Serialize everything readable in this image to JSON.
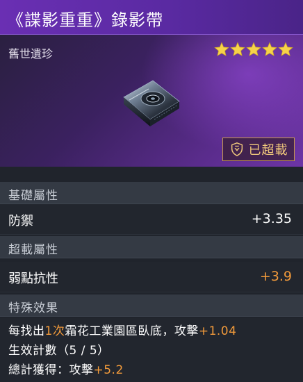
{
  "item": {
    "title": "《諜影重重》錄影帶",
    "rarity_label": "舊世遺珍",
    "stars": 5,
    "star_color": "#f6d34a",
    "status_badge": "已超載",
    "status_icon": "overload-shield-icon"
  },
  "sections": {
    "base": {
      "header": "基礎屬性",
      "stats": [
        {
          "name": "防禦",
          "value": "+3.35"
        }
      ]
    },
    "overload": {
      "header": "超載屬性",
      "stats": [
        {
          "name": "弱點抗性",
          "value": "+3.9"
        }
      ]
    },
    "special": {
      "header": "特殊效果",
      "line1_a": "每找出",
      "line1_b": "1次",
      "line1_c": "霜花工業園區臥底",
      "line1_d": "，攻擊",
      "line1_e": "+1.04",
      "line2": "生效計數（5 / 5）",
      "line3_a": "總計獲得：攻擊",
      "line3_b": "+5.2"
    }
  },
  "colors": {
    "title_bar": "#6a2fb3",
    "accent_orange": "#f39b3b",
    "badge_gold": "#f1c97c",
    "section_header_bg": "#343a44",
    "row_bg": "#22262e"
  }
}
